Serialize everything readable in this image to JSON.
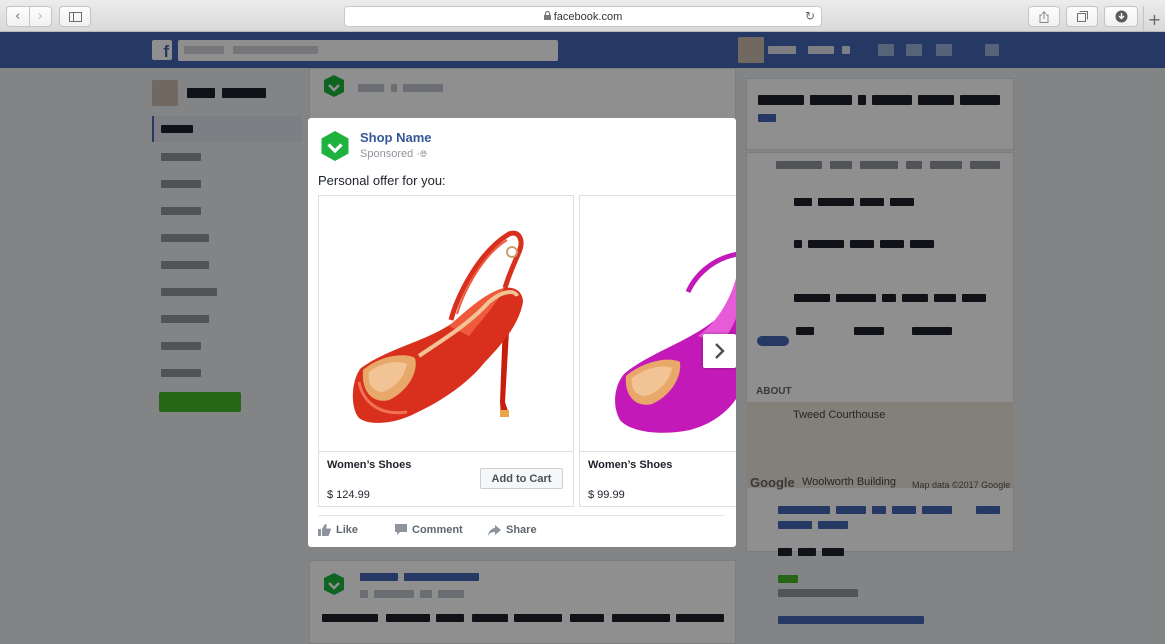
{
  "browser": {
    "url": "facebook.com",
    "back_icon": "chevron-left-icon",
    "forward_icon": "chevron-right-icon",
    "sidebar_icon": "sidebar-icon",
    "reload_icon": "reload-icon",
    "share_icon": "share-icon",
    "tabs_icon": "tabs-icon",
    "downloads_icon": "download-icon",
    "new_tab": "+"
  },
  "ad": {
    "shop_name": "Shop Name",
    "sponsored": "Sponsored",
    "sponsored_separator": "·",
    "offer_text": "Personal offer for you:",
    "products": [
      {
        "title": "Women’s Shoes",
        "price": "$ 124.99",
        "button": "Add to Cart",
        "color": "#d8301c"
      },
      {
        "title": "Women’s Shoes",
        "price": "$ 99.99",
        "color": "#c419b9"
      }
    ],
    "actions": {
      "like": "Like",
      "comment": "Comment",
      "share": "Share"
    }
  },
  "background_page": {
    "about": "ABOUT",
    "map_place": "Tweed Courthouse",
    "map_building": "Woolworth Building",
    "map_brand": "Google",
    "map_credit": "Map data ©2017 Google"
  },
  "colors": {
    "facebook_blue": "#4267b2",
    "link_blue": "#365899",
    "shield_green": "#1eb23e"
  }
}
